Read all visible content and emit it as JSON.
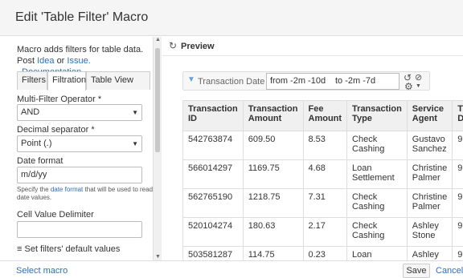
{
  "dialog": {
    "title": "Edit 'Table Filter' Macro"
  },
  "left": {
    "desc_text": "Macro adds filters for table data.",
    "post": "Post",
    "idea": "Idea",
    "or": "or",
    "issue": "Issue.",
    "documentation": "Documentation",
    "tabs": [
      {
        "label": "Filters"
      },
      {
        "label": "Filtration"
      },
      {
        "label": "Table View"
      }
    ],
    "multi_filter_label": "Multi-Filter Operator *",
    "multi_filter_value": "AND",
    "decimal_label": "Decimal separator *",
    "decimal_value": "Point (.)",
    "date_format_label": "Date format",
    "date_format_value": "m/d/yy",
    "help_prefix": "Specify the",
    "help_link": "date format",
    "help_suffix": "that will be used to read date values.",
    "delimiter_label": "Cell Value Delimiter",
    "delimiter_value": "",
    "defaults_label": "Set filters' default values"
  },
  "preview": {
    "label": "Preview",
    "filter_label": "Transaction Date =",
    "filter_from": "from  -2m -10d",
    "filter_to": "to  -2m -7d"
  },
  "table": {
    "headers": [
      "Transaction ID",
      "Transaction Amount",
      "Fee Amount",
      "Transaction Type",
      "Service Agent",
      "T D"
    ],
    "rows": [
      [
        "542763874",
        "609.50",
        "8.53",
        "Check Cashing",
        "Gustavo Sanchez",
        "9"
      ],
      [
        "566014297",
        "1169.75",
        "4.68",
        "Loan Settlement",
        "Christine Palmer",
        "9"
      ],
      [
        "562765190",
        "1218.75",
        "7.31",
        "Check Cashing",
        "Christine Palmer",
        "9"
      ],
      [
        "520104274",
        "180.63",
        "2.17",
        "Check Cashing",
        "Ashley Stone",
        "9"
      ],
      [
        "503581287",
        "114.75",
        "0.23",
        "Loan",
        "Ashley",
        "9"
      ]
    ]
  },
  "footer": {
    "select_macro": "Select macro",
    "save": "Save",
    "cancel": "Cancel"
  }
}
